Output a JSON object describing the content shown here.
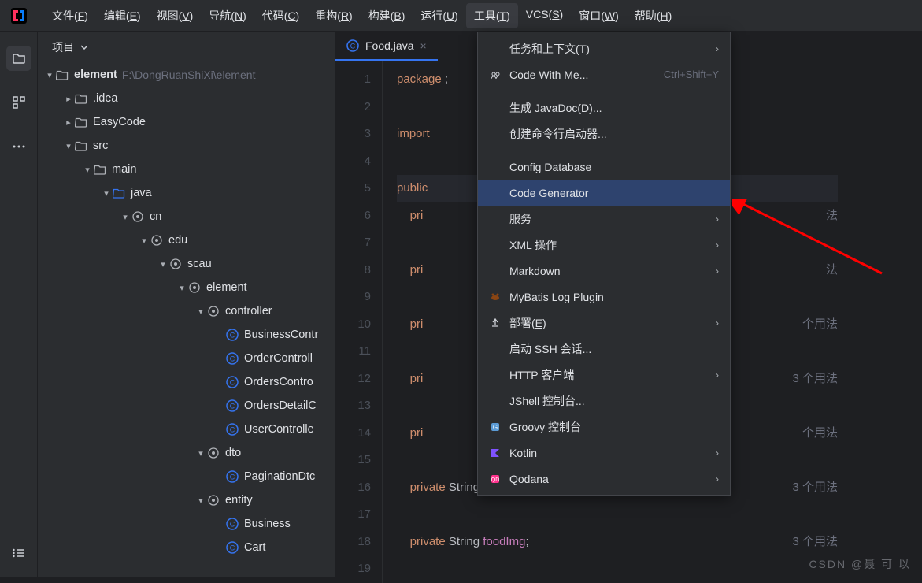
{
  "menubar": {
    "items": [
      {
        "label": "文件",
        "key": "F"
      },
      {
        "label": "编辑",
        "key": "E"
      },
      {
        "label": "视图",
        "key": "V"
      },
      {
        "label": "导航",
        "key": "N"
      },
      {
        "label": "代码",
        "key": "C"
      },
      {
        "label": "重构",
        "key": "R"
      },
      {
        "label": "构建",
        "key": "B"
      },
      {
        "label": "运行",
        "key": "U"
      },
      {
        "label": "工具",
        "key": "T"
      },
      {
        "label": "VCS",
        "key": "S"
      },
      {
        "label": "窗口",
        "key": "W"
      },
      {
        "label": "帮助",
        "key": "H"
      }
    ]
  },
  "sidebar": {
    "header": "项目",
    "root": {
      "name": "element",
      "path": "F:\\DongRuanShiXi\\element"
    },
    "nodes": [
      {
        "depth": 1,
        "chev": "right",
        "icon": "folder",
        "label": ".idea"
      },
      {
        "depth": 1,
        "chev": "right",
        "icon": "folder",
        "label": "EasyCode"
      },
      {
        "depth": 1,
        "chev": "down",
        "icon": "folder",
        "label": "src"
      },
      {
        "depth": 2,
        "chev": "down",
        "icon": "folder",
        "label": "main"
      },
      {
        "depth": 3,
        "chev": "down",
        "icon": "folder-src",
        "label": "java"
      },
      {
        "depth": 4,
        "chev": "down",
        "icon": "package",
        "label": "cn"
      },
      {
        "depth": 5,
        "chev": "down",
        "icon": "package",
        "label": "edu"
      },
      {
        "depth": 6,
        "chev": "down",
        "icon": "package",
        "label": "scau"
      },
      {
        "depth": 7,
        "chev": "down",
        "icon": "package",
        "label": "element"
      },
      {
        "depth": 8,
        "chev": "down",
        "icon": "package",
        "label": "controller"
      },
      {
        "depth": 9,
        "chev": "",
        "icon": "class",
        "label": "BusinessContr"
      },
      {
        "depth": 9,
        "chev": "",
        "icon": "class",
        "label": "OrderControll"
      },
      {
        "depth": 9,
        "chev": "",
        "icon": "class",
        "label": "OrdersContro"
      },
      {
        "depth": 9,
        "chev": "",
        "icon": "class",
        "label": "OrdersDetailC"
      },
      {
        "depth": 9,
        "chev": "",
        "icon": "class",
        "label": "UserControlle"
      },
      {
        "depth": 8,
        "chev": "down",
        "icon": "package",
        "label": "dto"
      },
      {
        "depth": 9,
        "chev": "",
        "icon": "class",
        "label": "PaginationDtc"
      },
      {
        "depth": 8,
        "chev": "down",
        "icon": "package",
        "label": "entity"
      },
      {
        "depth": 9,
        "chev": "",
        "icon": "class",
        "label": "Business"
      },
      {
        "depth": 9,
        "chev": "",
        "icon": "class",
        "label": "Cart"
      }
    ]
  },
  "editor": {
    "tab": {
      "name": "Food.java"
    },
    "lines": [
      {
        "n": 1,
        "tokens": [
          {
            "t": "package",
            "c": "kw"
          },
          {
            "t": " ",
            "c": ""
          }
        ],
        "tail": ";"
      },
      {
        "n": 2,
        "tokens": []
      },
      {
        "n": 3,
        "tokens": [
          {
            "t": "import",
            "c": "kw"
          },
          {
            "t": " ",
            "c": ""
          }
        ]
      },
      {
        "n": 4,
        "tokens": []
      },
      {
        "n": 5,
        "cursor": true,
        "tokens": [
          {
            "t": "public",
            "c": "kw"
          },
          {
            "t": " ",
            "c": ""
          }
        ]
      },
      {
        "n": 6,
        "indent": 1,
        "tokens": [
          {
            "t": "pri",
            "c": "kw"
          }
        ],
        "hint": "法"
      },
      {
        "n": 7,
        "tokens": []
      },
      {
        "n": 8,
        "indent": 1,
        "tokens": [
          {
            "t": "pri",
            "c": "kw"
          }
        ],
        "hint": "法"
      },
      {
        "n": 9,
        "tokens": []
      },
      {
        "n": 10,
        "indent": 1,
        "tokens": [
          {
            "t": "pri",
            "c": "kw"
          }
        ],
        "hint": "个用法"
      },
      {
        "n": 11,
        "tokens": []
      },
      {
        "n": 12,
        "indent": 1,
        "tokens": [
          {
            "t": "pri",
            "c": "kw"
          }
        ],
        "hint": "3 个用法"
      },
      {
        "n": 13,
        "tokens": []
      },
      {
        "n": 14,
        "indent": 1,
        "tokens": [
          {
            "t": "pri",
            "c": "kw"
          }
        ],
        "hint": "个用法"
      },
      {
        "n": 15,
        "tokens": []
      },
      {
        "n": 16,
        "indent": 1,
        "full": "private String remarks;",
        "hint": "3 个用法"
      },
      {
        "n": 17,
        "tokens": []
      },
      {
        "n": 18,
        "indent": 1,
        "full": "private String foodImg;",
        "hint": "3 个用法"
      },
      {
        "n": 19,
        "tokens": []
      }
    ]
  },
  "dropdown": {
    "items": [
      {
        "label": "任务和上下文",
        "key": "T",
        "submenu": true
      },
      {
        "icon": "cwm",
        "label": "Code With Me...",
        "shortcut": "Ctrl+Shift+Y"
      },
      {
        "sep": true
      },
      {
        "label": "生成 JavaDoc",
        "key": "D",
        "ellipsis": true
      },
      {
        "label": "创建命令行启动器..."
      },
      {
        "sep": true
      },
      {
        "label": "Config Database"
      },
      {
        "label": "Code Generator",
        "selected": true
      },
      {
        "label": "服务",
        "submenu": true
      },
      {
        "label": "XML 操作",
        "submenu": true
      },
      {
        "label": "Markdown",
        "submenu": true
      },
      {
        "icon": "mybatis",
        "label": "MyBatis Log Plugin"
      },
      {
        "icon": "deploy",
        "label": "部署",
        "key": "E",
        "submenu": true
      },
      {
        "label": "启动 SSH 会话..."
      },
      {
        "label": "HTTP 客户端",
        "submenu": true
      },
      {
        "label": "JShell 控制台..."
      },
      {
        "icon": "groovy",
        "label": "Groovy 控制台"
      },
      {
        "icon": "kotlin",
        "label": "Kotlin",
        "submenu": true
      },
      {
        "icon": "qodana",
        "label": "Qodana",
        "submenu": true
      }
    ]
  },
  "watermark": "CSDN @聂 可 以"
}
